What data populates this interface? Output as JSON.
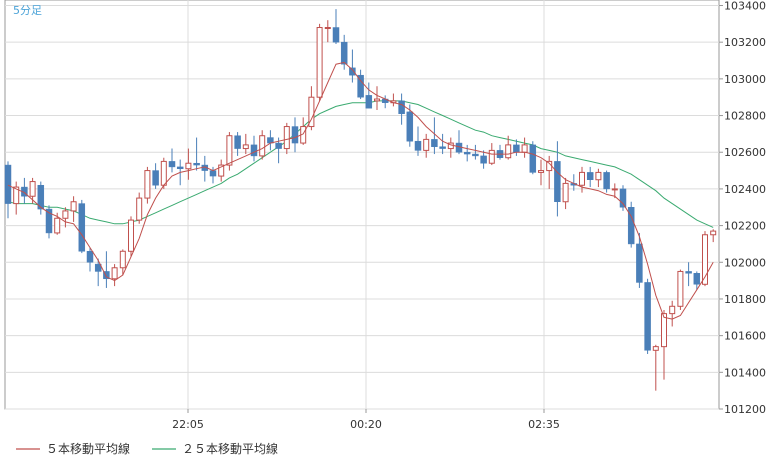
{
  "chart_data": {
    "type": "candlestick",
    "timeframe_label": "5分足",
    "x_ticks": [
      "22:05",
      "00:20",
      "02:35"
    ],
    "y_ticks": [
      101200,
      101400,
      101600,
      101800,
      102000,
      102200,
      102400,
      102600,
      102800,
      103000,
      103200,
      103400
    ],
    "ylim": [
      101200,
      103430
    ],
    "grid": true,
    "colors": {
      "background": "#ffffff",
      "grid": "#dcdcdc",
      "up": "#c0504d",
      "down": "#4a7fb8",
      "ma5": "#c0504d",
      "ma25": "#3aaa70",
      "label_blue": "#4ba3d8",
      "text": "#333333"
    },
    "legend": [
      {
        "label": "５本移動平均線",
        "color": "#c0504d"
      },
      {
        "label": "２５本移動平均線",
        "color": "#3aaa70"
      }
    ],
    "candles": [
      [
        102530,
        102550,
        102240,
        102320
      ],
      [
        102320,
        102440,
        102260,
        102410
      ],
      [
        102410,
        102460,
        102320,
        102360
      ],
      [
        102360,
        102460,
        102320,
        102440
      ],
      [
        102420,
        102440,
        102260,
        102290
      ],
      [
        102290,
        102310,
        102130,
        102160
      ],
      [
        102160,
        102270,
        102150,
        102240
      ],
      [
        102240,
        102300,
        102190,
        102280
      ],
      [
        102280,
        102360,
        102220,
        102330
      ],
      [
        102320,
        102340,
        102050,
        102060
      ],
      [
        102060,
        102080,
        101950,
        102000
      ],
      [
        101990,
        102020,
        101870,
        101950
      ],
      [
        101950,
        102060,
        101860,
        101910
      ],
      [
        101910,
        101990,
        101870,
        101970
      ],
      [
        101970,
        102070,
        101930,
        102060
      ],
      [
        102060,
        102250,
        102030,
        102230
      ],
      [
        102230,
        102380,
        102210,
        102350
      ],
      [
        102350,
        102520,
        102320,
        102500
      ],
      [
        102500,
        102540,
        102400,
        102420
      ],
      [
        102420,
        102570,
        102400,
        102550
      ],
      [
        102550,
        102620,
        102490,
        102520
      ],
      [
        102520,
        102560,
        102420,
        102510
      ],
      [
        102510,
        102620,
        102450,
        102540
      ],
      [
        102540,
        102680,
        102500,
        102530
      ],
      [
        102530,
        102580,
        102440,
        102500
      ],
      [
        102500,
        102520,
        102430,
        102470
      ],
      [
        102470,
        102560,
        102440,
        102530
      ],
      [
        102530,
        102710,
        102500,
        102690
      ],
      [
        102690,
        102710,
        102580,
        102620
      ],
      [
        102620,
        102700,
        102590,
        102640
      ],
      [
        102640,
        102690,
        102550,
        102580
      ],
      [
        102580,
        102720,
        102560,
        102690
      ],
      [
        102680,
        102720,
        102610,
        102650
      ],
      [
        102650,
        102680,
        102540,
        102620
      ],
      [
        102620,
        102760,
        102590,
        102740
      ],
      [
        102740,
        102790,
        102600,
        102650
      ],
      [
        102650,
        102790,
        102640,
        102740
      ],
      [
        102740,
        102960,
        102720,
        102900
      ],
      [
        102900,
        103300,
        102880,
        103280
      ],
      [
        103280,
        103320,
        103200,
        103280
      ],
      [
        103280,
        103380,
        103190,
        103200
      ],
      [
        103200,
        103240,
        103050,
        103080
      ],
      [
        103060,
        103160,
        102980,
        103020
      ],
      [
        103020,
        103050,
        102890,
        102900
      ],
      [
        102910,
        102980,
        102860,
        102840
      ],
      [
        102880,
        102960,
        102830,
        102890
      ],
      [
        102890,
        102910,
        102840,
        102870
      ],
      [
        102870,
        102920,
        102850,
        102880
      ],
      [
        102880,
        102920,
        102750,
        102810
      ],
      [
        102820,
        102860,
        102630,
        102660
      ],
      [
        102660,
        102740,
        102580,
        102610
      ],
      [
        102610,
        102700,
        102570,
        102670
      ],
      [
        102670,
        102790,
        102590,
        102630
      ],
      [
        102630,
        102700,
        102590,
        102620
      ],
      [
        102620,
        102680,
        102570,
        102650
      ],
      [
        102650,
        102720,
        102590,
        102600
      ],
      [
        102600,
        102640,
        102550,
        102590
      ],
      [
        102590,
        102640,
        102560,
        102580
      ],
      [
        102580,
        102610,
        102510,
        102540
      ],
      [
        102540,
        102650,
        102530,
        102610
      ],
      [
        102610,
        102640,
        102560,
        102570
      ],
      [
        102570,
        102690,
        102560,
        102640
      ],
      [
        102640,
        102670,
        102580,
        102600
      ],
      [
        102600,
        102680,
        102570,
        102640
      ],
      [
        102640,
        102660,
        102480,
        102490
      ],
      [
        102490,
        102560,
        102420,
        102500
      ],
      [
        102500,
        102580,
        102400,
        102550
      ],
      [
        102550,
        102660,
        102250,
        102330
      ],
      [
        102330,
        102460,
        102290,
        102430
      ],
      [
        102430,
        102480,
        102390,
        102420
      ],
      [
        102420,
        102520,
        102380,
        102490
      ],
      [
        102490,
        102520,
        102410,
        102450
      ],
      [
        102450,
        102510,
        102410,
        102490
      ],
      [
        102490,
        102500,
        102380,
        102400
      ],
      [
        102400,
        102430,
        102350,
        102400
      ],
      [
        102400,
        102420,
        102280,
        102300
      ],
      [
        102300,
        102330,
        102080,
        102100
      ],
      [
        102100,
        102160,
        101860,
        101890
      ],
      [
        101890,
        101910,
        101500,
        101520
      ],
      [
        101520,
        101550,
        101300,
        101540
      ],
      [
        101540,
        101740,
        101360,
        101720
      ],
      [
        101720,
        101790,
        101650,
        101760
      ],
      [
        101760,
        101960,
        101740,
        101950
      ],
      [
        101950,
        102000,
        101870,
        101940
      ],
      [
        101940,
        101950,
        101850,
        101880
      ],
      [
        101880,
        102170,
        101870,
        102150
      ],
      [
        102150,
        102180,
        102110,
        102170
      ]
    ],
    "ma5": [
      102420,
      102400,
      102380,
      102340,
      102300,
      102270,
      102250,
      102220,
      102210,
      102150,
      102080,
      102010,
      101920,
      101900,
      101930,
      102030,
      102130,
      102260,
      102350,
      102420,
      102470,
      102490,
      102500,
      102510,
      102520,
      102500,
      102520,
      102540,
      102560,
      102580,
      102600,
      102620,
      102650,
      102660,
      102670,
      102680,
      102700,
      102780,
      102880,
      102980,
      103080,
      103090,
      103050,
      102990,
      102940,
      102910,
      102890,
      102870,
      102860,
      102830,
      102790,
      102740,
      102700,
      102660,
      102640,
      102630,
      102620,
      102610,
      102600,
      102590,
      102590,
      102590,
      102600,
      102600,
      102590,
      102570,
      102540,
      102490,
      102450,
      102430,
      102410,
      102400,
      102390,
      102370,
      102360,
      102320,
      102250,
      102140,
      101990,
      101820,
      101700,
      101690,
      101710,
      101780,
      101850,
      101920,
      102000
    ],
    "ma25": [
      102330,
      102320,
      102320,
      102320,
      102310,
      102300,
      102300,
      102290,
      102280,
      102260,
      102240,
      102230,
      102220,
      102210,
      102210,
      102220,
      102230,
      102250,
      102270,
      102290,
      102310,
      102330,
      102350,
      102370,
      102390,
      102410,
      102430,
      102460,
      102480,
      102510,
      102540,
      102570,
      102600,
      102630,
      102660,
      102700,
      102740,
      102780,
      102810,
      102830,
      102850,
      102860,
      102870,
      102870,
      102870,
      102880,
      102880,
      102880,
      102880,
      102870,
      102860,
      102840,
      102820,
      102800,
      102780,
      102760,
      102740,
      102720,
      102710,
      102690,
      102680,
      102670,
      102660,
      102650,
      102640,
      102620,
      102610,
      102600,
      102580,
      102570,
      102560,
      102550,
      102540,
      102530,
      102520,
      102500,
      102480,
      102450,
      102420,
      102390,
      102350,
      102320,
      102290,
      102260,
      102230,
      102210,
      102190
    ]
  }
}
